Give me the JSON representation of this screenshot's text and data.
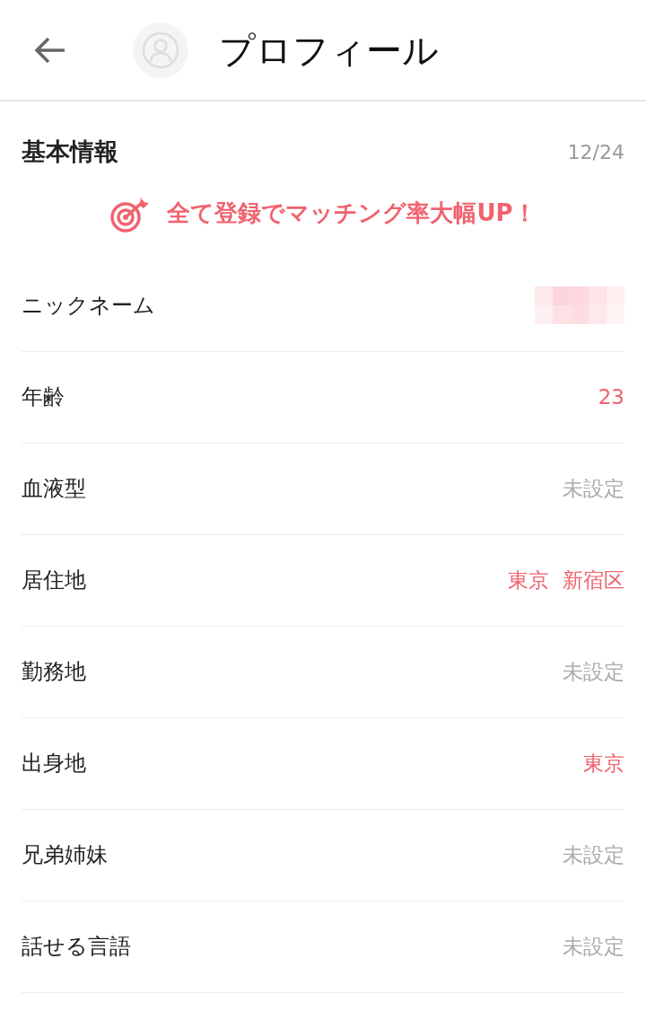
{
  "header": {
    "title": "プロフィール"
  },
  "section": {
    "title": "基本情報",
    "count": "12/24"
  },
  "banner": {
    "text": "全て登録でマッチング率大幅UP！"
  },
  "fields": [
    {
      "label": "ニックネーム",
      "kind": "redacted"
    },
    {
      "label": "年齢",
      "kind": "text",
      "value": "23",
      "set": true
    },
    {
      "label": "血液型",
      "kind": "text",
      "value": "未設定",
      "set": false
    },
    {
      "label": "居住地",
      "kind": "text",
      "value": "東京  新宿区",
      "set": true
    },
    {
      "label": "勤務地",
      "kind": "text",
      "value": "未設定",
      "set": false
    },
    {
      "label": "出身地",
      "kind": "text",
      "value": "東京",
      "set": true
    },
    {
      "label": "兄弟姉妹",
      "kind": "text",
      "value": "未設定",
      "set": false
    },
    {
      "label": "話せる言語",
      "kind": "text",
      "value": "未設定",
      "set": false
    }
  ]
}
